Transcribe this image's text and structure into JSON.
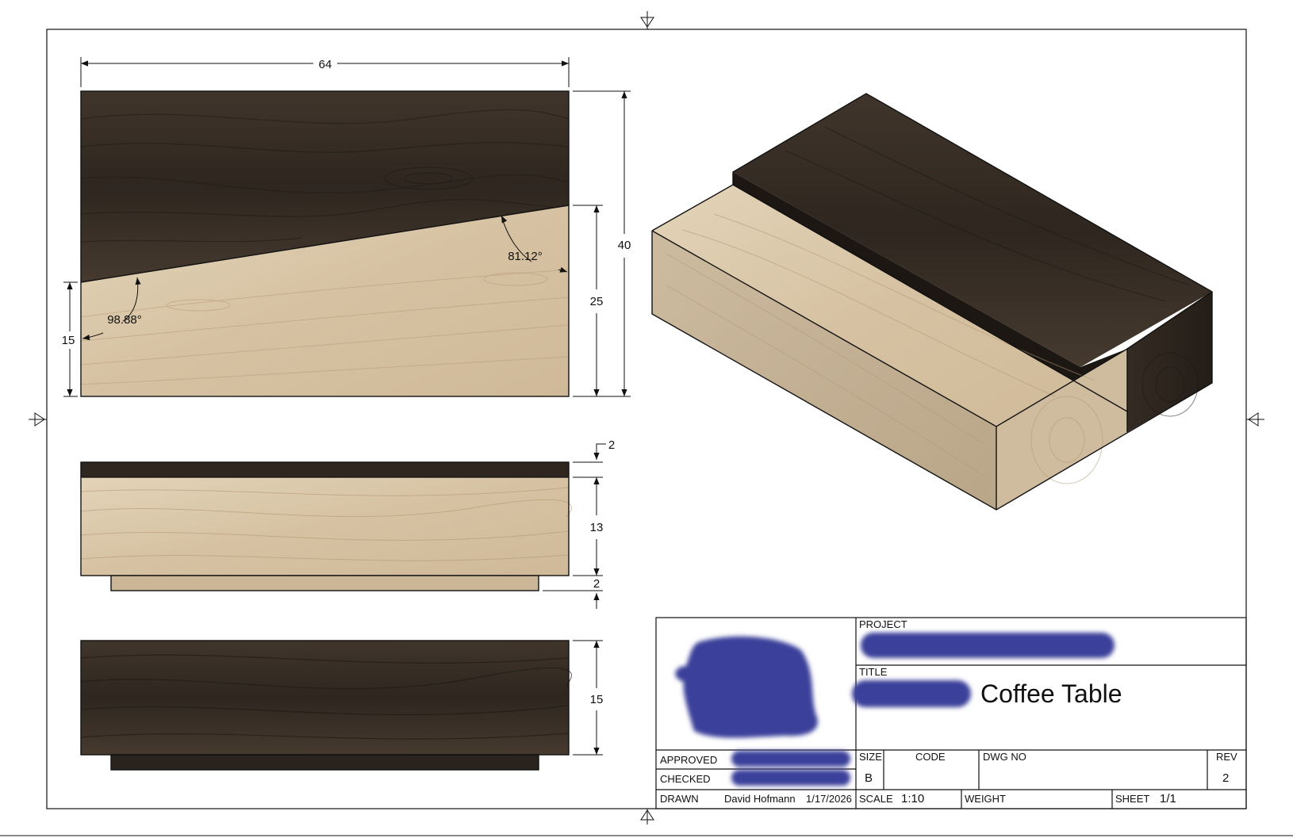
{
  "drawing": {
    "dimensions": {
      "width": "64",
      "height_total": "40",
      "light_height_right": "25",
      "light_height_left": "15",
      "angle_right": "81.12°",
      "angle_left": "98.88°",
      "top_strip": "2",
      "body": "13",
      "base": "2",
      "side_height": "15"
    },
    "title_block": {
      "project_label": "PROJECT",
      "title_label": "TITLE",
      "title_value": "Coffee Table",
      "approved_label": "APPROVED",
      "checked_label": "CHECKED",
      "drawn_label": "DRAWN",
      "drawn_by": "David Hofmann",
      "drawn_date": "1/17/2026",
      "size_label": "SIZE",
      "size_value": "B",
      "code_label": "CODE",
      "dwg_no_label": "DWG NO",
      "rev_label": "REV",
      "rev_value": "2",
      "scale_label": "SCALE",
      "scale_value": "1:10",
      "weight_label": "WEIGHT",
      "sheet_label": "SHEET",
      "sheet_value": "1/1"
    },
    "colors": {
      "dark_wood": "#3b3128",
      "light_wood": "#d9c6a8",
      "redaction": "#3a3f9a",
      "line": "#111111"
    }
  }
}
